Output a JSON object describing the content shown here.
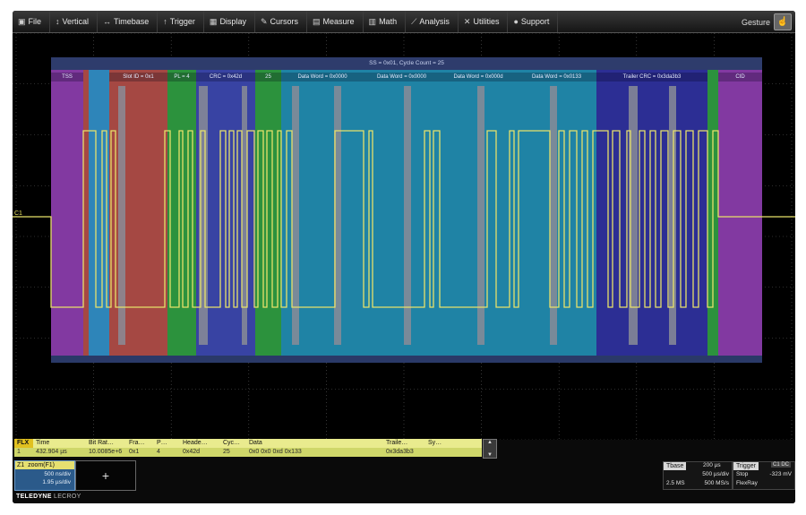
{
  "menubar": {
    "items": [
      {
        "icon": "file-icon",
        "glyph": "▣",
        "label": "File"
      },
      {
        "icon": "vertical-icon",
        "glyph": "↕",
        "label": "Vertical"
      },
      {
        "icon": "timebase-icon",
        "glyph": "↔",
        "label": "Timebase"
      },
      {
        "icon": "trigger-icon",
        "glyph": "↑",
        "label": "Trigger"
      },
      {
        "icon": "display-icon",
        "glyph": "▦",
        "label": "Display"
      },
      {
        "icon": "cursors-icon",
        "glyph": "✎",
        "label": "Cursors"
      },
      {
        "icon": "measure-icon",
        "glyph": "▤",
        "label": "Measure"
      },
      {
        "icon": "math-icon",
        "glyph": "▥",
        "label": "Math"
      },
      {
        "icon": "analysis-icon",
        "glyph": "⟋",
        "label": "Analysis"
      },
      {
        "icon": "utilities-icon",
        "glyph": "✕",
        "label": "Utilities"
      },
      {
        "icon": "support-icon",
        "glyph": "●",
        "label": "Support"
      }
    ],
    "gesture_label": "Gesture",
    "gesture_icon": "gesture-icon"
  },
  "decode": {
    "summary": "SS = 0x01, Cycle Count = 25",
    "segments": [
      {
        "label": "TSS",
        "color": "#8a3aa6"
      },
      {
        "label": "",
        "color": "#b04a40"
      },
      {
        "label": "",
        "color": "#2f8cc0"
      },
      {
        "label": "Slot ID = 0x1",
        "color": "#b04a40"
      },
      {
        "label": "PL = 4",
        "color": "#2c9a3a"
      },
      {
        "label": "CRC = 0x42d",
        "color": "#3a44a8"
      },
      {
        "label": "25",
        "color": "#2c9a3a"
      },
      {
        "label": "Data Word = 0x0000",
        "color": "#1e8aaa"
      },
      {
        "label": "Data Word = 0x0000",
        "color": "#1e8aaa"
      },
      {
        "label": "Data Word = 0x000d",
        "color": "#1e8aaa"
      },
      {
        "label": "Data Word = 0x0133",
        "color": "#1e8aaa"
      },
      {
        "label": "Trailer CRC = 0x3da3b3",
        "color": "#2c2e98"
      },
      {
        "label": "",
        "color": "#2c9a3a"
      },
      {
        "label": "CID",
        "color": "#8a3aa6"
      }
    ],
    "channel_label": "C1"
  },
  "table": {
    "tag": "FLX",
    "headers": [
      "Time",
      "Bit Rat…",
      "Fra…",
      "P…",
      "Heade…",
      "Cyc…",
      "Data",
      "Traile…",
      "Sy…"
    ],
    "row": [
      "432.904 µs",
      "10.0085e+6",
      "0x1",
      "4",
      "0x42d",
      "25",
      "0x0 0x0 0xd 0x133",
      "0x3da3b3",
      ""
    ]
  },
  "zoom": {
    "tag": "Z1",
    "name": "zoom(F1)",
    "line1": "500 ns/div",
    "line2": "1.95 µs/div"
  },
  "add_button": "+",
  "logo": {
    "brand": "TELEDYNE",
    "sub": "LECROY"
  },
  "timebase": {
    "tag": "Tbase",
    "offset": "200 µs",
    "line1a": "500 µs/div",
    "line2a": "2.5 MS",
    "line2b": "500 MS/s"
  },
  "trigger": {
    "tag": "Trigger",
    "icons": "C1 DC",
    "line1a": "Stop",
    "line1b": "-323 mV",
    "line2a": "FlexRay"
  },
  "colors": {
    "trace": "#e8e26a",
    "background": "#000000",
    "decode_band": "#2a3968",
    "grid": "#5a5a5a"
  }
}
